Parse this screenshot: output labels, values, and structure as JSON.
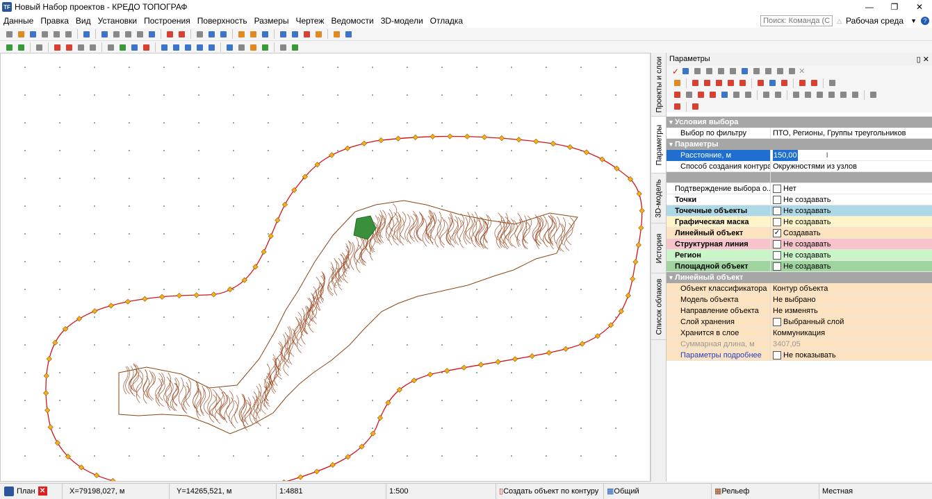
{
  "window": {
    "title": "Новый Набор проектов - КРЕДО ТОПОГРАФ",
    "app_badge": "TF"
  },
  "menu": {
    "items": [
      "Данные",
      "Правка",
      "Вид",
      "Установки",
      "Построения",
      "Поверхность",
      "Размеры",
      "Чертеж",
      "Ведомости",
      "3D-модели",
      "Отладка"
    ],
    "search_placeholder": "Поиск: Команда (С...",
    "workspace_label": "Рабочая среда"
  },
  "side_tabs": [
    "Проекты и слои",
    "Параметры",
    "3D-модель",
    "История",
    "Список облаков"
  ],
  "panel": {
    "title": "Параметры",
    "sections": [
      {
        "title": "Условия выбора",
        "rows": [
          {
            "label": "Выбор по фильтру",
            "value": "ПТО, Регионы, Группы треугольников"
          }
        ]
      },
      {
        "title": "Параметры",
        "rows": [
          {
            "label": "Расстояние, м",
            "value": "150,00",
            "editing": true
          },
          {
            "label": "Способ создания контура",
            "value": "Окружностями из узлов"
          },
          {
            "label": "",
            "value": "",
            "blank": true
          },
          {
            "label": "Подтверждение выбора о...",
            "value": "Нет",
            "checkbox": false,
            "top": true
          },
          {
            "label": "Точки",
            "value": "Не создавать",
            "checkbox": false,
            "top": true,
            "bold": true,
            "bg": "#ffffff"
          },
          {
            "label": "Точечные объекты",
            "value": "Не создавать",
            "checkbox": false,
            "top": true,
            "bold": true,
            "bg": "#add8e6"
          },
          {
            "label": "Графическая маска",
            "value": "Не создавать",
            "checkbox": false,
            "top": true,
            "bold": true,
            "bg": "#fff5c8"
          },
          {
            "label": "Линейный объект",
            "value": "Создавать",
            "checkbox": true,
            "top": true,
            "bold": true,
            "bg": "#fde2bf"
          },
          {
            "label": "Структурная линия",
            "value": "Не создавать",
            "checkbox": false,
            "top": true,
            "bold": true,
            "bg": "#f7c4cc"
          },
          {
            "label": "Регион",
            "value": "Не создавать",
            "checkbox": false,
            "top": true,
            "bold": true,
            "bg": "#c9f5c9"
          },
          {
            "label": "Площадной объект",
            "value": "Не создавать",
            "checkbox": false,
            "top": true,
            "bold": true,
            "bg": "#9fd49f"
          }
        ]
      },
      {
        "title": "Линейный объект",
        "bg": "#fde2bf",
        "rows": [
          {
            "label": "Объект классификатора",
            "value": "Контур объекта"
          },
          {
            "label": "Модель объекта",
            "value": "Не выбрано"
          },
          {
            "label": "Направление объекта",
            "value": "Не изменять"
          },
          {
            "label": "Слой хранения",
            "value": "Выбранный слой",
            "checkbox": false
          },
          {
            "label": "Хранится в слое",
            "value": "Коммуникация"
          },
          {
            "label": "Суммарная длина, м",
            "value": "3407,05",
            "disabled": true
          },
          {
            "label": "Параметры подробнее",
            "value": "Не показывать",
            "checkbox": false,
            "link": true
          }
        ]
      }
    ]
  },
  "status": {
    "tab": "План",
    "x": "X=79198,027, м",
    "y": "Y=14265,521, м",
    "scale1": "1:4881",
    "scale2": "1:500",
    "command": "Создать объект по контуру",
    "layer": "Общий",
    "surface": "Рельеф",
    "crs": "Местная"
  },
  "colors": {
    "contour": "#d41414",
    "vertex": "#f2b318",
    "relief": "#8b4513",
    "selection": "#1f6fd0"
  }
}
